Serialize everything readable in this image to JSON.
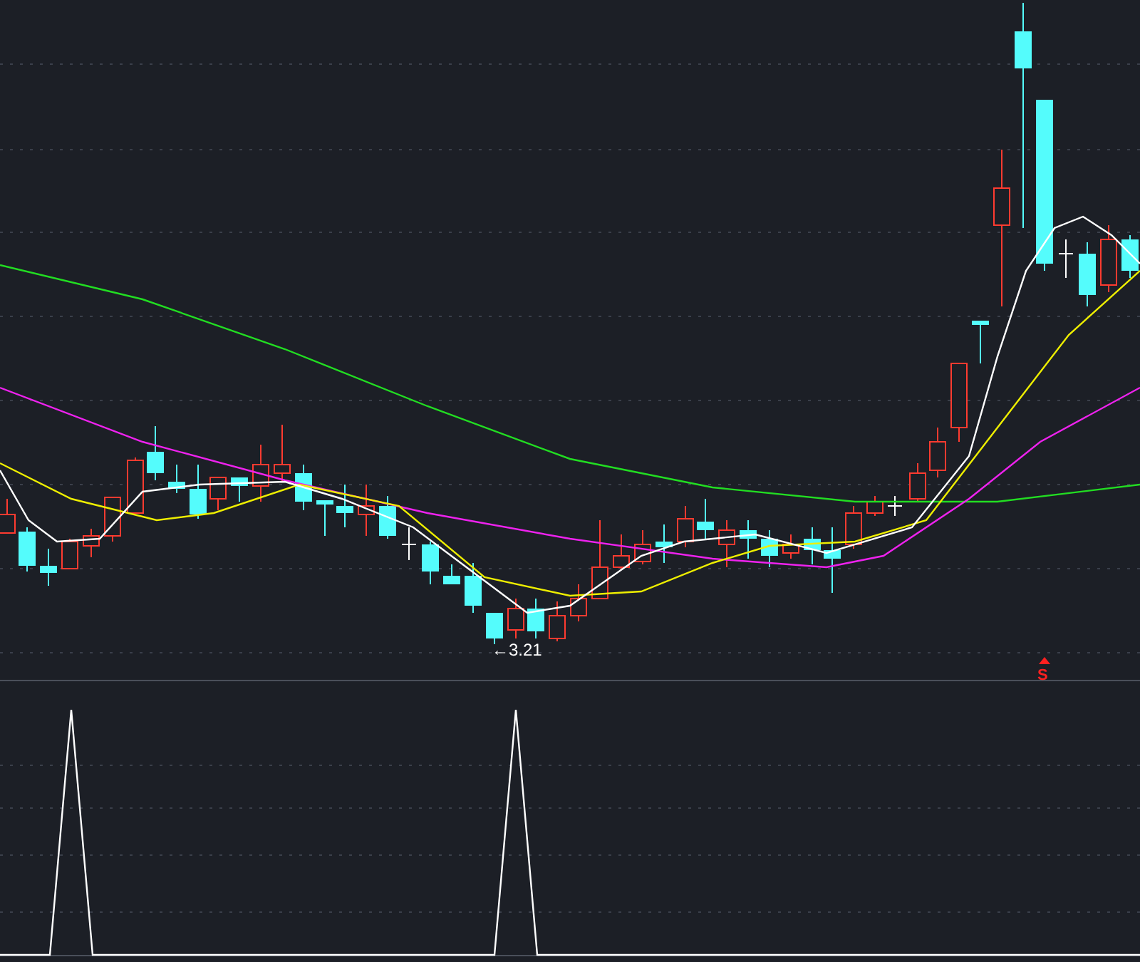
{
  "main_chart": {
    "low_label": "←3.21",
    "signal_mark": "S"
  }
}
